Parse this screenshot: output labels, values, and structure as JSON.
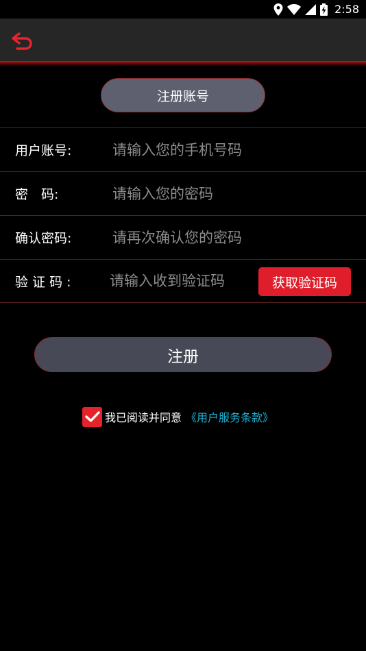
{
  "status_bar": {
    "time": "2:58"
  },
  "header": {
    "title": "注册账号"
  },
  "form": {
    "account": {
      "label": "用户账号:",
      "placeholder": "请输入您的手机号码"
    },
    "password": {
      "label": "密　码:",
      "placeholder": "请输入您的密码"
    },
    "confirm_password": {
      "label": "确认密码:",
      "placeholder": "请再次确认您的密码"
    },
    "verification": {
      "label": "验 证 码 :",
      "placeholder": "请输入收到验证码",
      "button_label": "获取验证码"
    }
  },
  "register_button": {
    "label": "注册"
  },
  "agreement": {
    "text": "我已阅读并同意",
    "link": "《用户服务条款》",
    "checked": true
  },
  "colors": {
    "accent": "#e01d2a",
    "link": "#1eb6d6",
    "pill": "#5e6070",
    "button": "#474a56"
  }
}
